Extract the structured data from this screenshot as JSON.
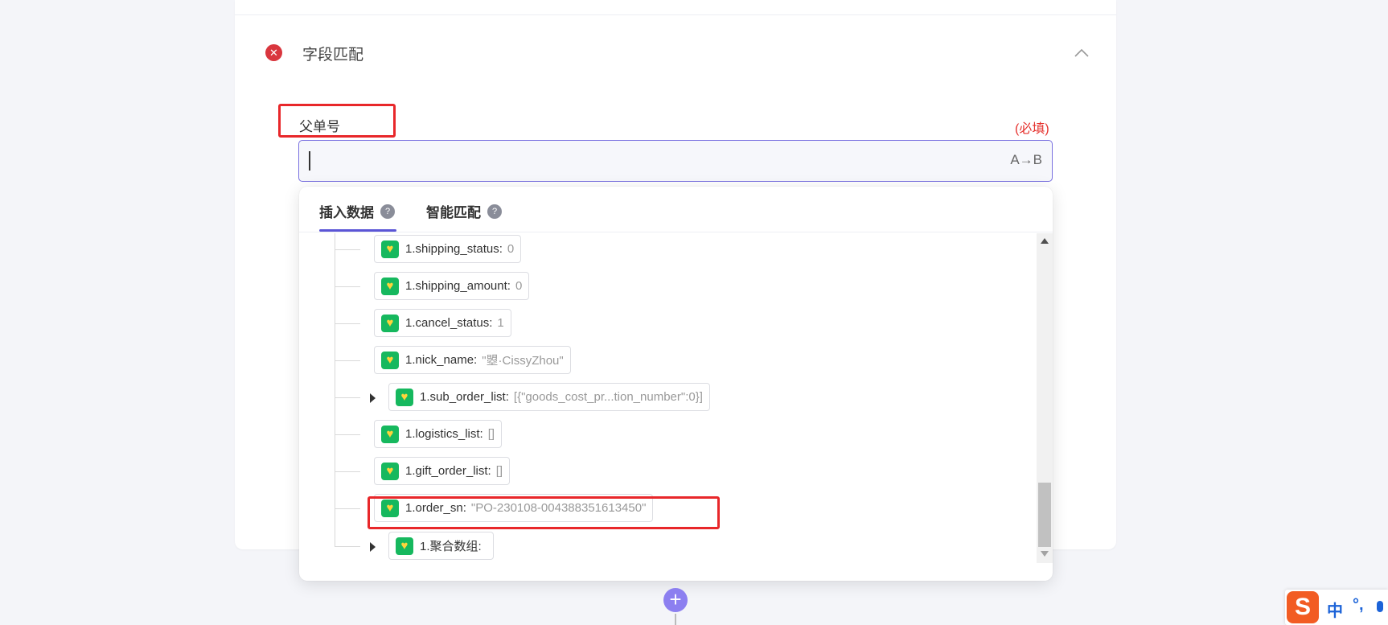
{
  "section": {
    "title": "字段匹配",
    "icon": "error-circle-icon",
    "collapse_icon": "chevron-up-icon"
  },
  "field": {
    "label": "父单号",
    "required": "(必填)",
    "value": "",
    "transform_label": "A→B"
  },
  "popup": {
    "tabs": [
      {
        "label": "插入数据",
        "help": "?"
      },
      {
        "label": "智能匹配",
        "help": "?"
      }
    ],
    "active_tab": 0,
    "tree_items": [
      {
        "key": "1.shipping_status:",
        "value": "0",
        "expandable": false
      },
      {
        "key": "1.shipping_amount:",
        "value": "0",
        "expandable": false
      },
      {
        "key": "1.cancel_status:",
        "value": "1",
        "expandable": false
      },
      {
        "key": "1.nick_name:",
        "value": "\"曌·CissyZhou\"",
        "expandable": false
      },
      {
        "key": "1.sub_order_list:",
        "value": "[{\"goods_cost_pr...tion_number\":0}]",
        "expandable": true
      },
      {
        "key": "1.logistics_list:",
        "value": "[]",
        "expandable": false
      },
      {
        "key": "1.gift_order_list:",
        "value": "[]",
        "expandable": false
      },
      {
        "key": "1.order_sn:",
        "value": "\"PO-230108-004388351613450\"",
        "expandable": false
      },
      {
        "key": "1.聚合数组:",
        "value": "",
        "expandable": true
      }
    ]
  },
  "add_step": {
    "label": "+"
  },
  "ime": {
    "logo": "S",
    "mode": "中",
    "punct": "°,"
  },
  "colors": {
    "accent": "#5b55d6",
    "error": "#d9363e",
    "highlight_box": "#e8272a",
    "app_icon": "#16b85e"
  }
}
